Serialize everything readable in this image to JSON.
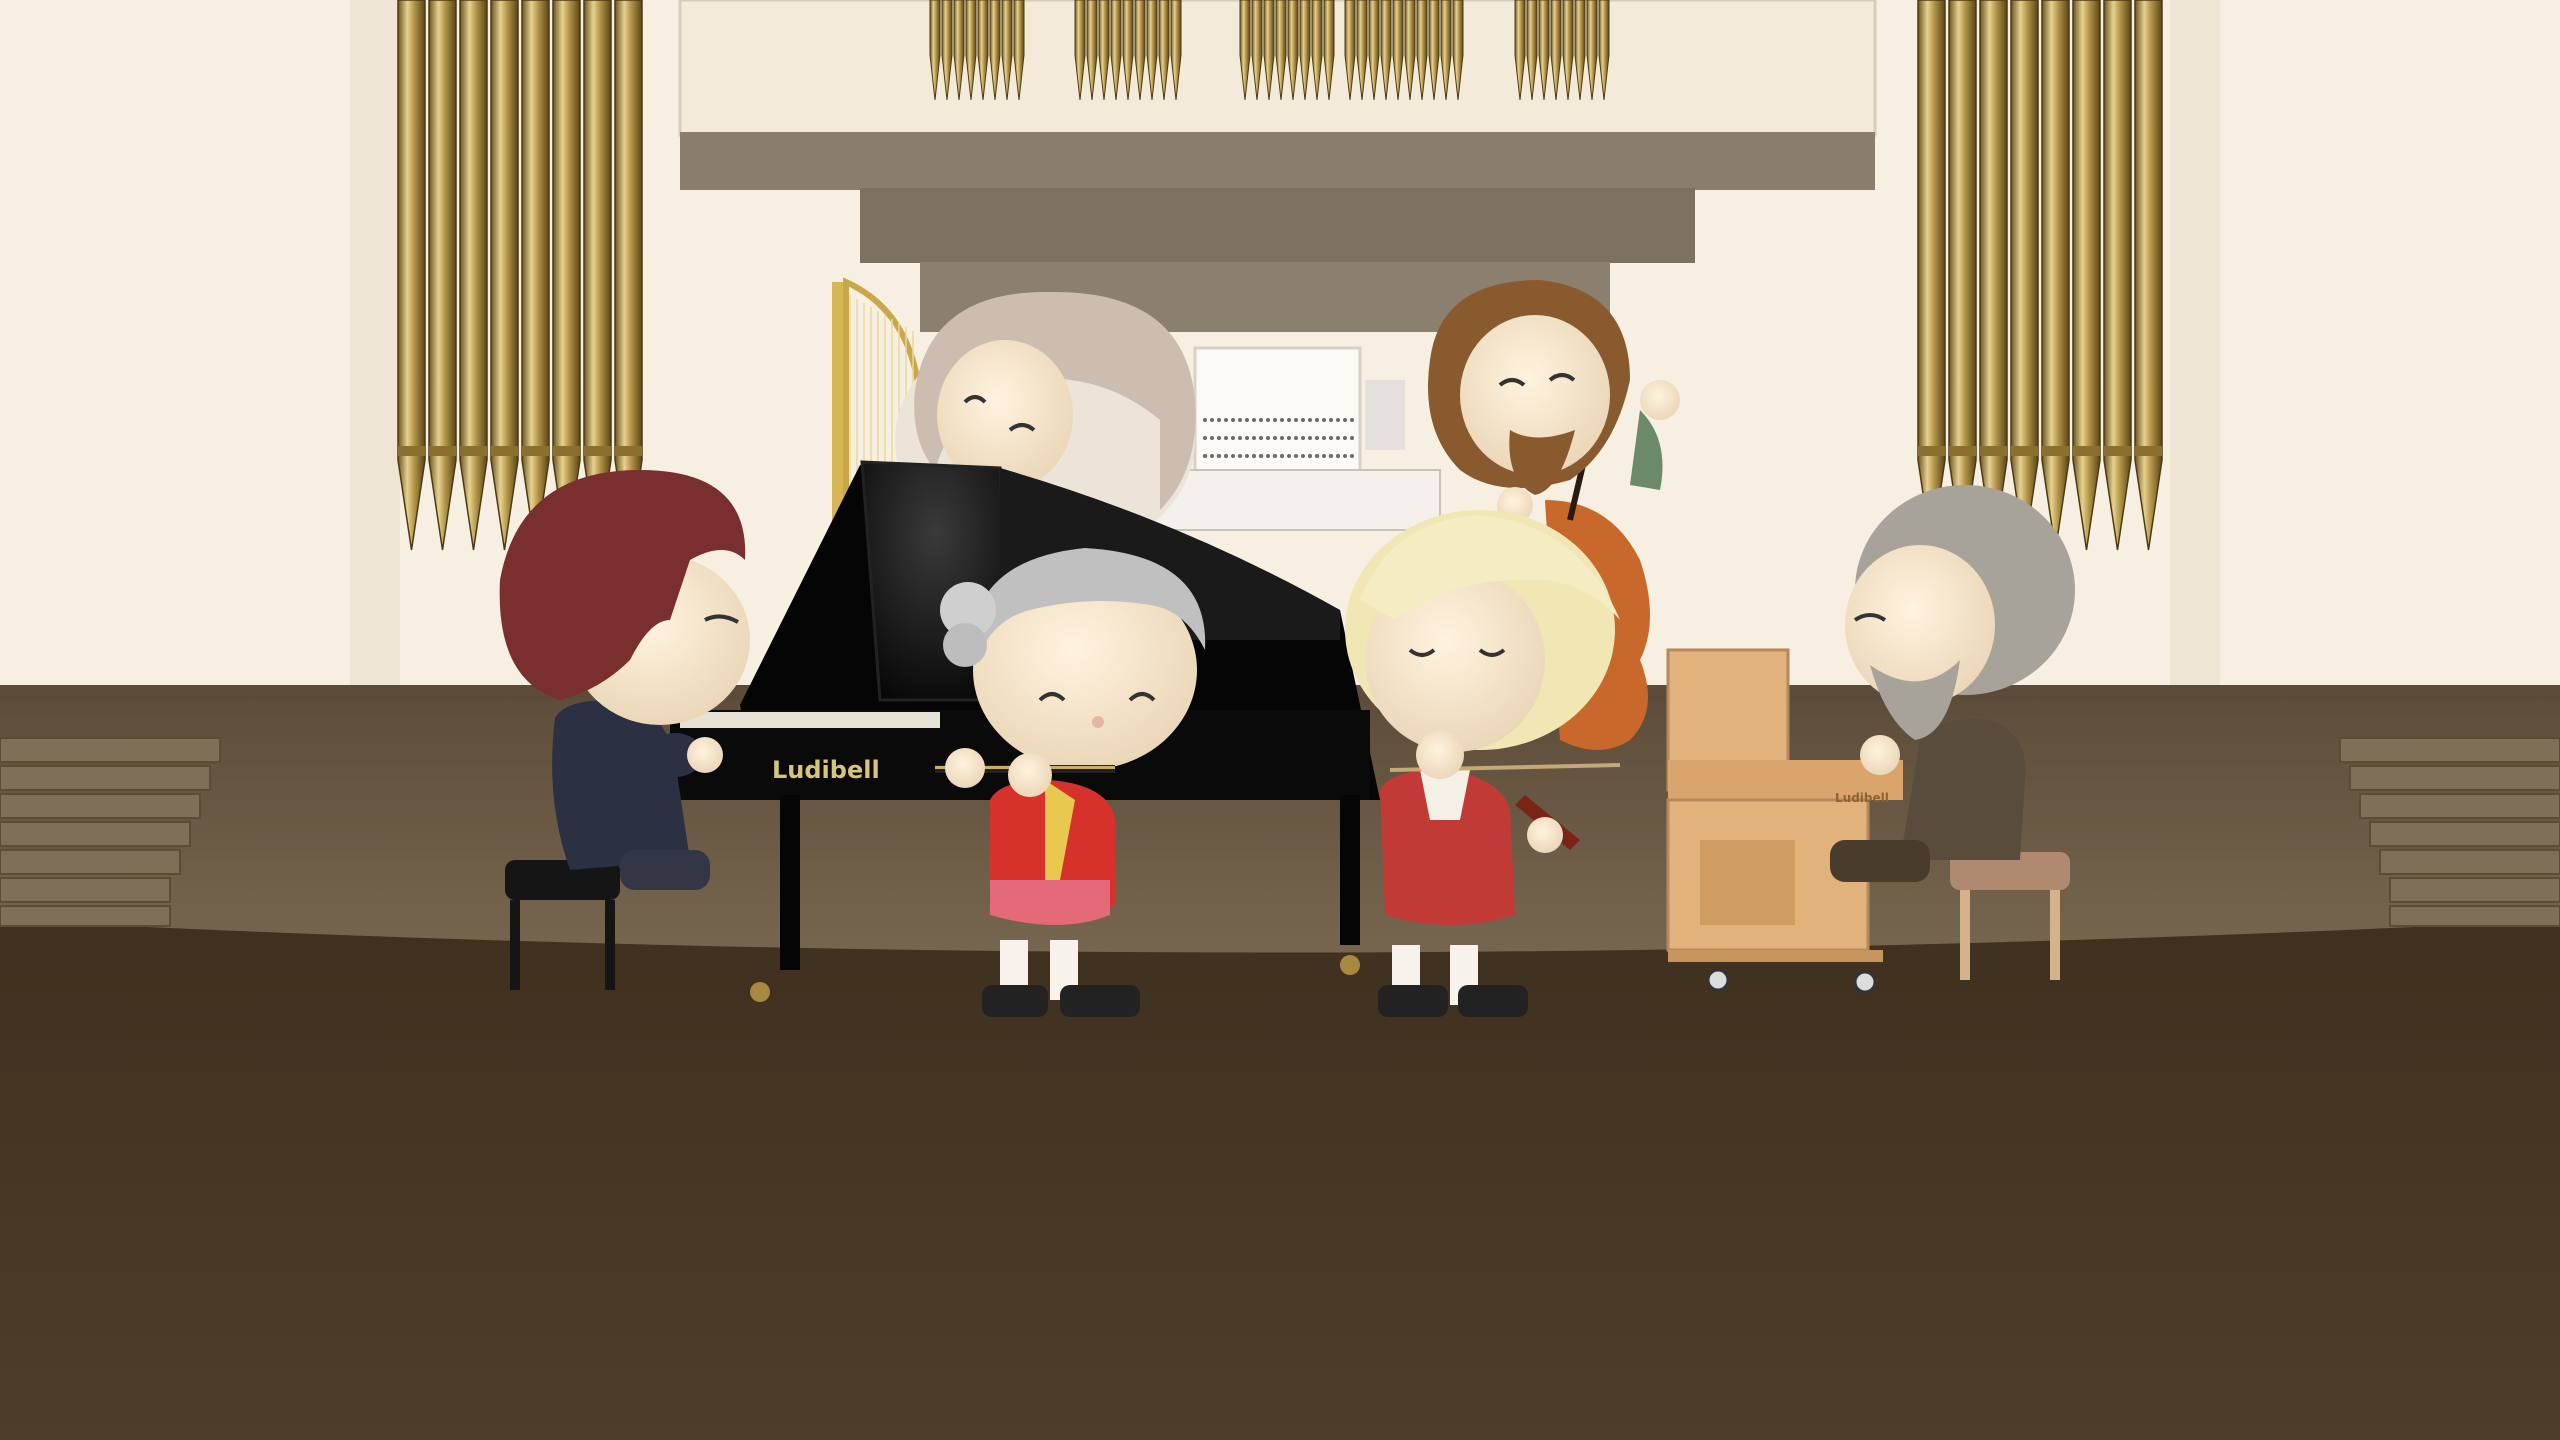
{
  "scene": {
    "title": "",
    "piano_brand": "Ludibell",
    "harmonium_brand": "Ludibell"
  },
  "colors": {
    "wall": "#f7efe2",
    "pipe_gold": "#b59a55",
    "stage_floor": "#4a3a28",
    "stage_back": "#6b5a44",
    "balcony": "#857868",
    "piano_black": "#111111",
    "coat_red": "#c8332d",
    "cello_orange": "#c8682a",
    "harmonium_tan": "#e2b27c"
  },
  "characters": [
    {
      "id": "pianist",
      "hair": "#7a2f2f",
      "outfit": "#2b3042",
      "pose": "seated-playing-grand-piano"
    },
    {
      "id": "conductor-behind-piano",
      "hair": "#cbb9ae",
      "outfit": "#e8e0d6",
      "pose": "smiling"
    },
    {
      "id": "flautist",
      "hair": "#bdbdbd",
      "outfit": "#d6322b",
      "pose": "standing-playing-flute"
    },
    {
      "id": "cellist",
      "hair": "#8a5a2f",
      "outfit": "#6a8a6a",
      "pose": "standing-playing-cello"
    },
    {
      "id": "violinist",
      "hair": "#f1e7b4",
      "outfit": "#c23a36",
      "pose": "standing-playing-violin"
    },
    {
      "id": "harmonium-player",
      "hair": "#a8a39a",
      "outfit": "#5a4c3c",
      "pose": "seated-playing-harmonium"
    }
  ]
}
